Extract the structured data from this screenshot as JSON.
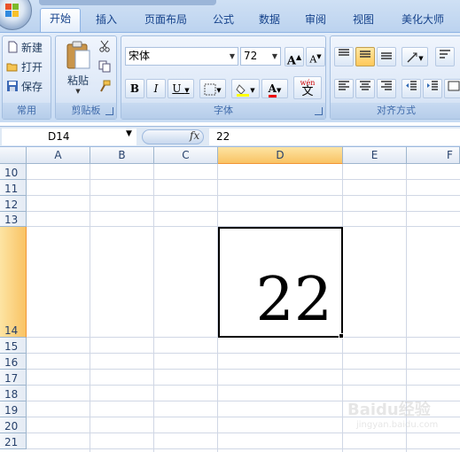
{
  "ribbon_tabs": [
    {
      "label": "开始",
      "active": true
    },
    {
      "label": "插入"
    },
    {
      "label": "页面布局"
    },
    {
      "label": "公式"
    },
    {
      "label": "数据"
    },
    {
      "label": "审阅"
    },
    {
      "label": "视图"
    },
    {
      "label": "美化大师"
    }
  ],
  "groups": {
    "common": {
      "label": "常用",
      "new": "新建",
      "open": "打开",
      "save": "保存"
    },
    "clipboard": {
      "label": "剪贴板",
      "paste": "粘贴"
    },
    "font": {
      "label": "字体",
      "font_name": "宋体",
      "font_size": "72",
      "bold": "B",
      "italic": "I",
      "underline": "U",
      "grow": "A",
      "shrink": "A",
      "font_color_letter": "A",
      "phonetic": "wén"
    },
    "align": {
      "label": "对齐方式"
    }
  },
  "formula_bar": {
    "name_box": "D14",
    "fx": "fx",
    "formula": "22"
  },
  "columns": [
    "A",
    "B",
    "C",
    "D",
    "E",
    "F"
  ],
  "rows": [
    "10",
    "11",
    "12",
    "13",
    "14",
    "15",
    "16",
    "17",
    "18",
    "19",
    "20",
    "21"
  ],
  "active_cell": {
    "ref": "D14",
    "value": "22"
  },
  "colors": {
    "selected_header": "#f9c364",
    "ribbon": "#dbe8f7"
  },
  "watermark": {
    "text": "Baidu经验",
    "sub": "jingyan.baidu.com"
  }
}
